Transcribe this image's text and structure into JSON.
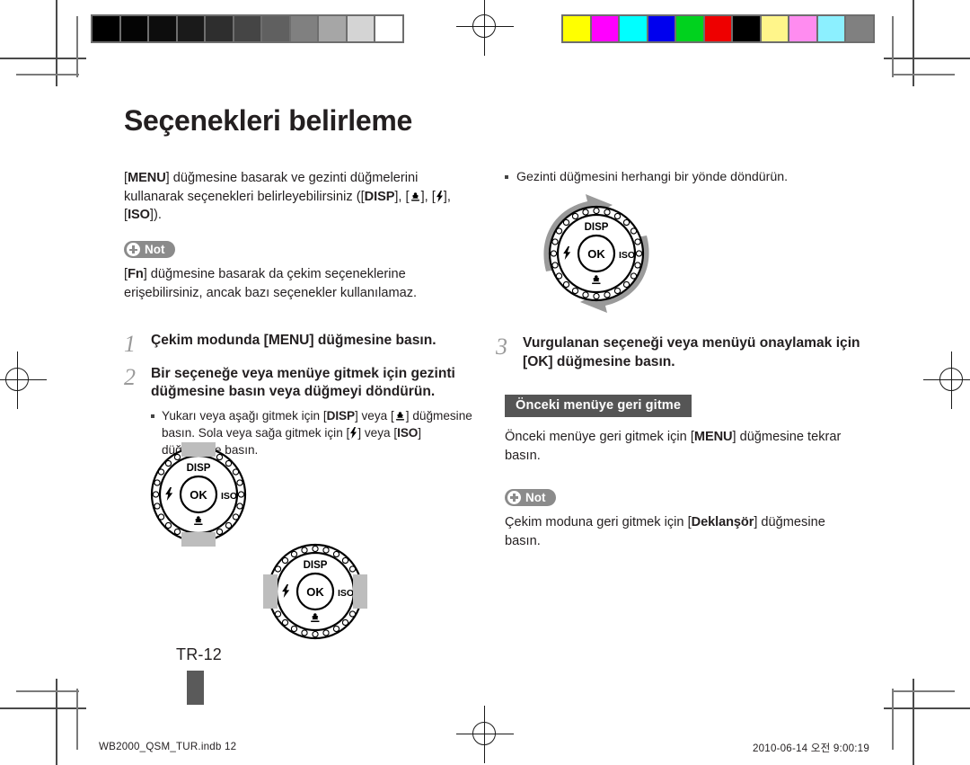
{
  "document": {
    "title": "Seçenekleri belirleme",
    "page_label": "TR-12",
    "footer_left": "WB2000_QSM_TUR.indb   12",
    "footer_right": "2010-06-14   오전 9:00:19"
  },
  "left_column": {
    "intro": {
      "part1": "] düğmesine basarak ve gezinti düğmelerini kullanarak seçenekleri belirleyebilirsiniz ([",
      "menu": "MENU",
      "open_bracket": "[",
      "disp": "DISP",
      "mid1": "], [",
      "mid2": "], [",
      "iso": "ISO",
      "end": "])."
    },
    "note1": {
      "badge_label": "Not",
      "text_pre": "[",
      "fn": "Fn",
      "text_post": "] düğmesine basarak da çekim seçeneklerine erişebilirsiniz, ancak bazı seçenekler kullanılamaz."
    },
    "steps": [
      {
        "number": "1",
        "text_pre": "Çekim modunda [",
        "kbd": "MENU",
        "text_post": "] düğmesine basın."
      },
      {
        "number": "2",
        "text": "Bir seçeneğe veya menüye gitmek için gezinti düğmesine basın veya düğmeyi döndürün."
      }
    ],
    "step2_sub": {
      "s1": "Yukarı veya aşağı gitmek için [",
      "disp": "DISP",
      "s2": "] veya [",
      "s3": "] düğmesine basın. Sola veya sağa gitmek için [",
      "s4": "] veya [",
      "iso": "ISO",
      "s5": "] düğmesine basın."
    },
    "dials": [
      {
        "name": "dial-up-down",
        "labels": {
          "top": "DISP",
          "right": "ISO",
          "center": "OK"
        },
        "highlight": "vertical"
      },
      {
        "name": "dial-left-right",
        "labels": {
          "top": "DISP",
          "right": "ISO",
          "center": "OK"
        },
        "highlight": "horizontal"
      }
    ]
  },
  "right_column": {
    "rotate_bullet": "Gezinti düğmesini herhangi bir yönde döndürün.",
    "rotate_dial": {
      "labels": {
        "top": "DISP",
        "right": "ISO",
        "center": "OK"
      }
    },
    "step3": {
      "number": "3",
      "text_pre": "Vurgulanan seçeneği veya menüyü onaylamak için [",
      "kbd": "OK",
      "text_post": "] düğmesine basın."
    },
    "section_heading": "Önceki menüye geri gitme",
    "section_body": {
      "pre": "Önceki menüye geri gitmek için [",
      "kbd": "MENU",
      "post": "] düğmesine tekrar basın."
    },
    "note2": {
      "badge_label": "Not",
      "pre": "Çekim moduna geri gitmek için [",
      "kbd": "Deklanşör",
      "post": "] düğmesine basın."
    }
  },
  "calibration": {
    "grayscale_label": "grayscale-step-wedge",
    "grayscale_patches": [
      "#000000",
      "#040404",
      "#0d0d0d",
      "#1a1a1a",
      "#2e2e2e",
      "#454545",
      "#606060",
      "#808080",
      "#a6a6a6",
      "#d4d4d4",
      "#ffffff"
    ],
    "color_label": "color-control-patches",
    "color_patches": [
      "#ffff00",
      "#ff00ff",
      "#00ffff",
      "#0000ee",
      "#00d21e",
      "#ee0000",
      "#000000",
      "#fff58a",
      "#ff8cf0",
      "#8cf0ff",
      "#808080"
    ]
  }
}
